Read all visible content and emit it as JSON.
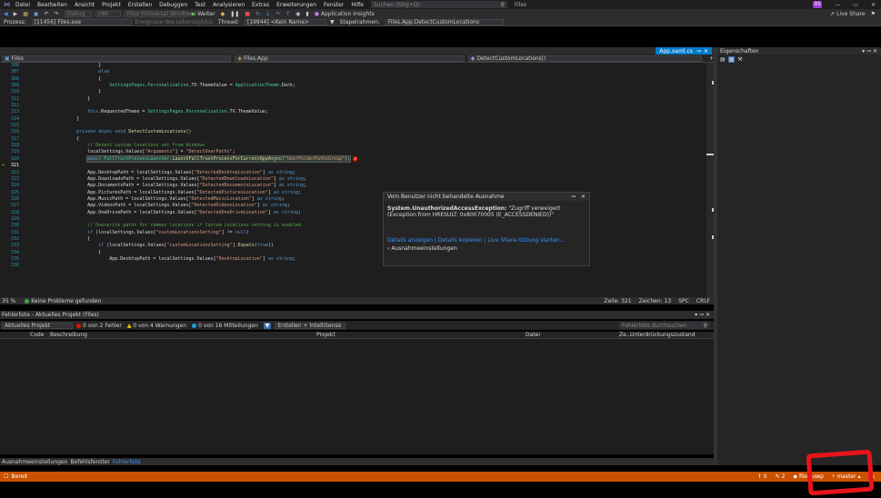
{
  "menu": {
    "items": [
      "Datei",
      "Bearbeiten",
      "Ansicht",
      "Projekt",
      "Erstellen",
      "Debuggen",
      "Test",
      "Analysieren",
      "Extras",
      "Erweiterungen",
      "Fenster",
      "Hilfe"
    ],
    "search_placeholder": "Suchen (Strg+Q)",
    "solution": "Files",
    "avatar": "RS",
    "live_share": "Live Share"
  },
  "toolbar": {
    "config": "Debug",
    "platform": "x86",
    "target": "Files (Universal Windows)",
    "continue": "Weiter",
    "app_insights": "Application Insights"
  },
  "toolbar2": {
    "process_label": "Prozess:",
    "process_value": "[11456] Files.exe",
    "lifecycle": "Ereignisse des Lebenszyklus",
    "thread_label": "Thread:",
    "thread_value": "[19944] <Kein Name>",
    "stack_label": "Stapelrahmen:",
    "stack_value": "Files.App.DetectCustomLocations"
  },
  "editor": {
    "tab": "App.xaml.cs",
    "nav_left": "Files",
    "nav_mid": "Files.App",
    "nav_right": "DetectCustomLocations()",
    "line_numbers": [
      "306",
      "307",
      "308",
      "309",
      "310",
      "311",
      "312",
      "313",
      "314",
      "315",
      "316",
      "317",
      "318",
      "319",
      "320",
      "321",
      "322",
      "323",
      "324",
      "325",
      "326",
      "327",
      "328",
      "329",
      "330",
      "331",
      "332",
      "333",
      "334",
      "335",
      "336"
    ],
    "zoom": "35 %",
    "no_problems": "Keine Probleme gefunden",
    "row_col": "Zeile: 321",
    "char": "Zeichen: 13",
    "spc": "SPC",
    "crlf": "CRLF"
  },
  "exception": {
    "title": "Vom Benutzer nicht behandelte Ausnahme",
    "type": "System.UnauthorizedAccessException:",
    "message": "\"Zugriff verweigert (Exception from HRESULT: 0x80070005 (E_ACCESSDENIED))\"",
    "link1": "Details anzeigen",
    "link2": "Details kopieren",
    "link3": "Live Share-Sitzung starten...",
    "settings": "Ausnahmeeinstellungen"
  },
  "errorlist": {
    "title": "Fehlerliste - Aktuelles Projekt (Files)",
    "scope": "Aktuelles Projekt",
    "errors": "0 von 2 Fehler",
    "warnings": "0 von 4 Warnungen",
    "messages": "0 von 16 Mitteilungen",
    "build": "Erstellen + IntelliSense",
    "search": "Fehlerliste durchsuchen",
    "columns": [
      "Code",
      "Beschreibung",
      "Projekt",
      "Datei",
      "Ze...",
      "Unterdrückungszustand"
    ]
  },
  "bottom_tabs": [
    "Ausnahmeeinstellungen",
    "Befehlsfenster",
    "Fehlerliste"
  ],
  "properties": {
    "title": "Eigenschaften"
  },
  "status": {
    "ready": "Bereit",
    "up": "0",
    "pencil": "2",
    "repo": "files-uwp",
    "branch": "master"
  }
}
